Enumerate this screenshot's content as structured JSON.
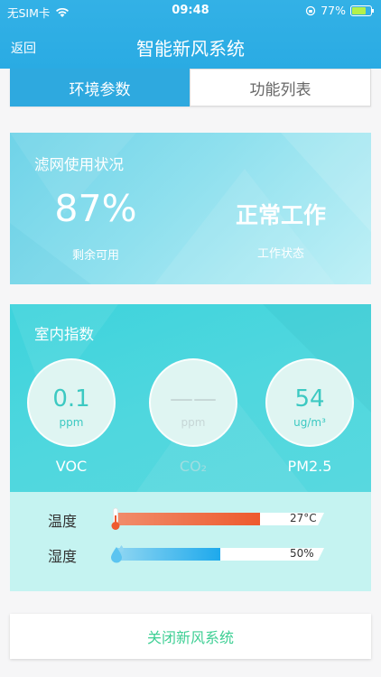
{
  "status_bar": {
    "carrier": "无SIM卡",
    "time": "09:48",
    "battery": "77%"
  },
  "nav": {
    "back": "返回",
    "title": "智能新风系统"
  },
  "tabs": [
    {
      "label": "环境参数",
      "active": true
    },
    {
      "label": "功能列表",
      "active": false
    }
  ],
  "filter_card": {
    "title": "滤网使用状况",
    "remaining_value": "87%",
    "remaining_label": "剩余可用",
    "status_value": "正常工作",
    "status_label": "工作状态"
  },
  "indoor_card": {
    "title": "室内指数",
    "gauges": [
      {
        "value": "0.1",
        "unit": "ppm",
        "label": "VOC",
        "enabled": true
      },
      {
        "value": "——",
        "unit": "ppm",
        "label": "CO₂",
        "enabled": false
      },
      {
        "value": "54",
        "unit": "ug/m³",
        "label": "PM2.5",
        "enabled": true
      }
    ]
  },
  "meters": {
    "temperature": {
      "label": "温度",
      "value": "27°C",
      "level": 0.69
    },
    "humidity": {
      "label": "湿度",
      "value": "50%",
      "level": 0.5
    }
  },
  "action": {
    "label": "关闭新风系统"
  },
  "colors": {
    "header": "#2aabe3",
    "accent_green": "#3ecf94",
    "temp_bar": "#ee5a2e",
    "humidity_bar": "#1ea9ec"
  }
}
